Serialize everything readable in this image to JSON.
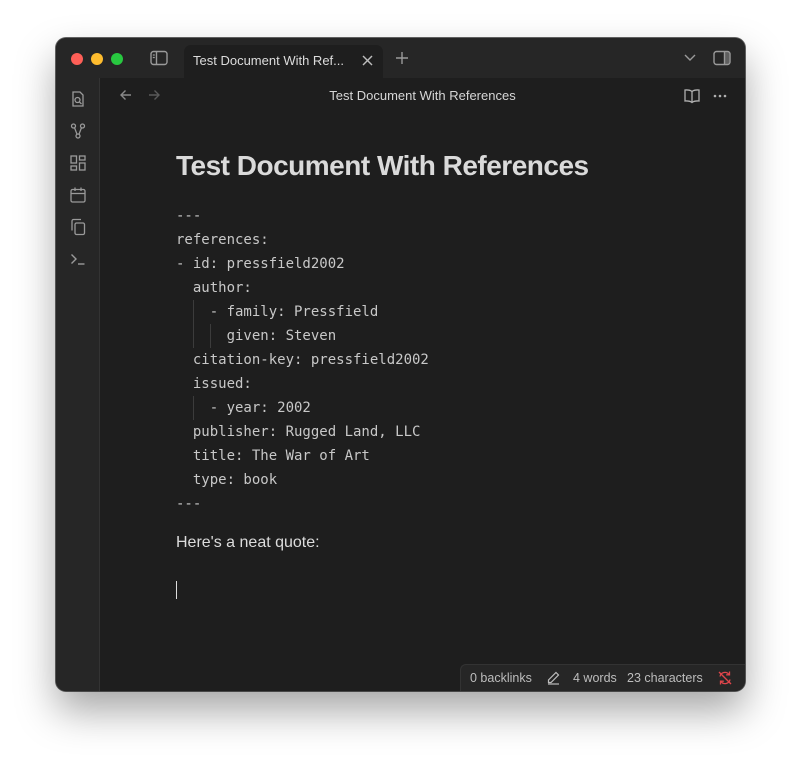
{
  "window": {
    "tab": {
      "label": "Test Document With Ref...",
      "close_icon": "close-icon"
    },
    "new_tab_icon": "plus-icon",
    "sidebar_toggle_icon": "sidebar-left-icon",
    "tab_list_icon": "chevron-down-icon",
    "right_sidebar_icon": "sidebar-right-icon"
  },
  "ribbon": {
    "items": [
      {
        "name": "open-quick-switcher",
        "icon": "file-search-icon"
      },
      {
        "name": "graph-view",
        "icon": "graph-icon"
      },
      {
        "name": "canvas",
        "icon": "layout-dashboard-icon"
      },
      {
        "name": "daily-note",
        "icon": "calendar-icon"
      },
      {
        "name": "templates",
        "icon": "copy-icon"
      },
      {
        "name": "command-palette",
        "icon": "terminal-icon"
      }
    ]
  },
  "view": {
    "title": "Test Document With References",
    "back_icon": "arrow-left-icon",
    "forward_icon": "arrow-right-icon",
    "reading_view_icon": "book-open-icon",
    "more_options_icon": "more-horizontal-icon"
  },
  "document": {
    "heading": "Test Document With References",
    "frontmatter_lines": [
      "---",
      "references:",
      "- id: pressfield2002",
      "  author:",
      "    - family: Pressfield",
      "      given: Steven",
      "  citation-key: pressfield2002",
      "  issued:",
      "    - year: 2002",
      "  publisher: Rugged Land, LLC",
      "  title: The War of Art",
      "  type: book",
      "---"
    ],
    "paragraph": "Here's a neat quote:"
  },
  "statusbar": {
    "backlinks": "0 backlinks",
    "edit_icon": "pencil-icon",
    "words": "4 words",
    "characters": "23 characters",
    "sync_icon": "sync-off-icon",
    "sync_color": "#e0454b"
  },
  "colors": {
    "background": "#1e1e1e",
    "chrome": "#262626",
    "text": "#dcdcdc",
    "muted_icon": "#9a9a9a"
  }
}
